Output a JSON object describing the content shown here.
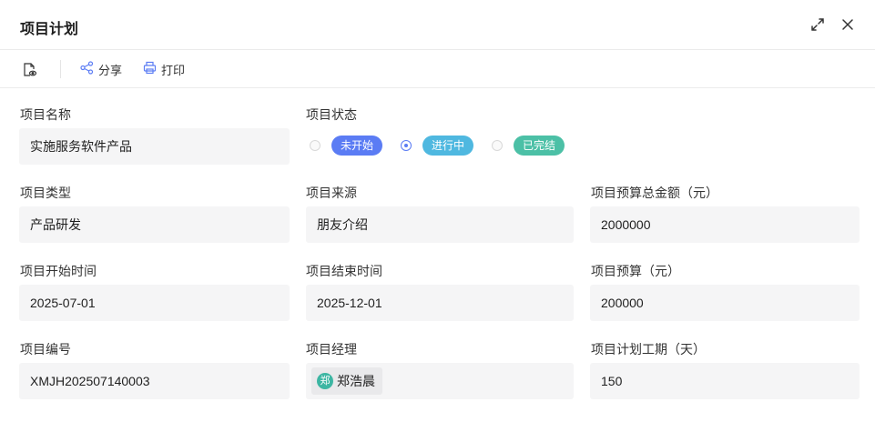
{
  "header": {
    "title": "项目计划"
  },
  "toolbar": {
    "share_label": "分享",
    "print_label": "打印"
  },
  "form": {
    "project_name": {
      "label": "项目名称",
      "value": "实施服务软件产品"
    },
    "project_status": {
      "label": "项目状态",
      "options": [
        {
          "label": "未开始",
          "color": "#5b7cf4",
          "checked": false
        },
        {
          "label": "进行中",
          "color": "#4fb8e0",
          "checked": true
        },
        {
          "label": "已完结",
          "color": "#4cc0a6",
          "checked": false
        }
      ]
    },
    "project_type": {
      "label": "项目类型",
      "value": "产品研发"
    },
    "project_source": {
      "label": "项目来源",
      "value": "朋友介绍"
    },
    "total_budget": {
      "label": "项目预算总金额（元）",
      "value": "2000000"
    },
    "start_time": {
      "label": "项目开始时间",
      "value": "2025-07-01"
    },
    "end_time": {
      "label": "项目结束时间",
      "value": "2025-12-01"
    },
    "budget": {
      "label": "项目预算（元）",
      "value": "200000"
    },
    "project_number": {
      "label": "项目编号",
      "value": "XMJH202507140003"
    },
    "manager": {
      "label": "项目经理",
      "avatar_text": "郑",
      "name": "郑浩晨"
    },
    "duration": {
      "label": "项目计划工期（天）",
      "value": "150"
    }
  },
  "icons": {
    "expand": "expand-icon",
    "close": "close-icon",
    "view": "document-view-icon",
    "share": "share-icon",
    "print": "printer-icon",
    "accent": "#5b7cf4"
  }
}
